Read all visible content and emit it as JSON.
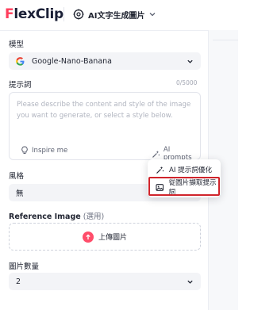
{
  "header": {
    "logo_text": "FlexClip",
    "tool_tab_label": "AI文字生成圖片"
  },
  "model": {
    "label": "模型",
    "selected": "Google-Nano-Banana"
  },
  "prompt": {
    "label": "提示詞",
    "counter": "0/5000",
    "placeholder": "Please describe the content and style of the image you want to generate, or select a style below.",
    "inspire_label": "Inspire me",
    "ai_prompts_label": "AI prompts"
  },
  "style": {
    "label": "風格",
    "selected": "無"
  },
  "reference": {
    "label": "Reference Image",
    "label_suffix": "(選用)",
    "upload_label": "上傳圖片"
  },
  "count": {
    "label": "圖片數量",
    "selected": "2"
  },
  "ai_prompts_menu": {
    "items": [
      {
        "label": "AI 提示詞優化",
        "icon": "magic-wand-icon"
      },
      {
        "label": "從圖片擷取提示詞",
        "icon": "image-scan-icon"
      }
    ],
    "highlighted_index": 1
  },
  "colors": {
    "brand": "#ff3d5b",
    "highlight_box": "#d0242b",
    "upload_button": "#ff4d6a"
  }
}
